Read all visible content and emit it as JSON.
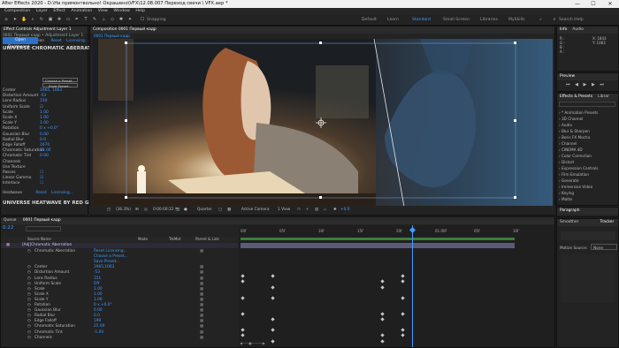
{
  "titlebar": {
    "title": "After Effects 2020 - D:\\На примонтвольно! Окрашено\\VFX\\12.08.007 Переход свечи \\ VFX.aep *",
    "minimize": "—",
    "maximize": "☐",
    "close": "✕"
  },
  "menu": [
    "Composition",
    "Layer",
    "Effect",
    "Animation",
    "View",
    "Window",
    "Help"
  ],
  "toolbar": {
    "snapping": "Snapping",
    "workspaces": [
      "Default",
      "Learn",
      "Standard",
      "Small Screen",
      "Libraries",
      "MySkills"
    ],
    "active_workspace": "Standard",
    "search_placeholder": "Search Help"
  },
  "effect_controls": {
    "tab": "Effect Controls Adjustment Layer 1",
    "breadcrumb": "0001 Первый кадр • Adjustment Layer 1",
    "effect_name": "Chromatic Aberration",
    "reset": "Reset",
    "licensing": "Licensing...",
    "plugin_title": "UNIVERSE CHROMATIC ABERRATION BY RE",
    "dashboard_button": "Open Dashboard...",
    "presets": [
      "Choose a Preset...",
      "Save Preset..."
    ],
    "params": [
      {
        "name": "Center",
        "value": "1965, 1063"
      },
      {
        "name": "Distortion Amount",
        "value": "-53"
      },
      {
        "name": "Lens Radius",
        "value": "150"
      },
      {
        "name": "Uniform Scale",
        "value": "☑"
      },
      {
        "name": "Scale",
        "value": "1.00"
      },
      {
        "name": "Scale X",
        "value": "1.00"
      },
      {
        "name": "Scale Y",
        "value": "1.00"
      },
      {
        "name": "Rotation",
        "value": "0 x +0.0°"
      },
      {
        "name": "Gaussian Blur",
        "value": "0.00"
      },
      {
        "name": "Radial Blur",
        "value": "0.0"
      },
      {
        "name": "Edge Falloff",
        "value": "1670"
      },
      {
        "name": "Chromatic Saturation",
        "value": "25.00"
      },
      {
        "name": "Chromatic Tint",
        "value": "0.00"
      },
      {
        "name": "Channels",
        "value": ""
      },
      {
        "name": "Use Texture",
        "value": ""
      },
      {
        "name": "Passes",
        "value": "☐"
      },
      {
        "name": "Linear Gamma",
        "value": "☑"
      },
      {
        "name": "Interlace",
        "value": "☐"
      }
    ],
    "heatwave_title": "UNIVERSE HEATWAVE BY RED GIANT",
    "heatwave_label": "Heatwave",
    "heatwave_reset": "Reset"
  },
  "composition": {
    "tab": "Composition 0001 Первый кадр",
    "comp_name": "0001 Первый кадр",
    "viewbar": {
      "zoom": "(36.3%)",
      "timecode": "0:00:00:22",
      "resolution": "Quarter",
      "camera": "Active Camera",
      "views": "1 View",
      "exposure": "+0.0"
    }
  },
  "right_panel": {
    "info_tab": "Info",
    "audio_tab": "Audio",
    "info_lines": [
      "R :",
      "G :",
      "B :",
      "A :"
    ],
    "coords": [
      "X: 1843",
      "Y: 1063"
    ],
    "preview_tab": "Preview",
    "effects_tab": "Effects & Presets",
    "library_tab": "Librar",
    "effects_categories": [
      "* Animation Presets",
      "3D Channel",
      "Audio",
      "Blur & Sharpen",
      "Boris FX Mocha",
      "Channel",
      "CINEMA 4D",
      "Color Correction",
      "Distort",
      "Expression Controls",
      "Film Emulation",
      "Generate",
      "Immersive Video",
      "Keying",
      "Matte"
    ],
    "paragraph_tab": "Paragraph",
    "smoother_tab": "Smoother",
    "tracker_tab": "Tracker",
    "motion_source_label": "Motion Source:",
    "motion_source_value": "None"
  },
  "timeline": {
    "tab": "0001 Первый кадр",
    "queue_tab": "Queue",
    "timecode": "0:22",
    "columns": [
      "Source Name",
      "Mode",
      "TrkMat",
      "Parent & Link"
    ],
    "layer_name": "[Adj]Chromatic Aberration",
    "ruler": [
      "00f",
      "05f",
      "10f",
      "15f",
      "20f",
      "01:00f",
      "05f",
      "10f"
    ],
    "rows": [
      {
        "name": "Chromatic Aberration",
        "value": "Reset   Licensing..."
      },
      {
        "name": "",
        "value": "Choose a Preset..."
      },
      {
        "name": "",
        "value": "Save Preset..."
      },
      {
        "name": "Center",
        "value": "1965,1063"
      },
      {
        "name": "Distortion Amount",
        "value": "-53"
      },
      {
        "name": "Lens Radius",
        "value": "151"
      },
      {
        "name": "Uniform Scale",
        "value": "Off"
      },
      {
        "name": "Scale",
        "value": "1.00"
      },
      {
        "name": "Scale X",
        "value": "1.00"
      },
      {
        "name": "Scale Y",
        "value": "1.00"
      },
      {
        "name": "Rotation",
        "value": "0 x +0.0°"
      },
      {
        "name": "Gaussian Blur",
        "value": "0.00"
      },
      {
        "name": "Radial Blur",
        "value": "0.0"
      },
      {
        "name": "Edge Falloff",
        "value": "199"
      },
      {
        "name": "Chromatic Saturation",
        "value": "25.00"
      },
      {
        "name": "Chromatic Tint",
        "value": "-1.00"
      },
      {
        "name": "Channels",
        "value": ""
      }
    ]
  },
  "colors": {
    "accent": "#3f9bff",
    "playhead": "#3f9bff",
    "work_area": "#3a7f3a"
  }
}
